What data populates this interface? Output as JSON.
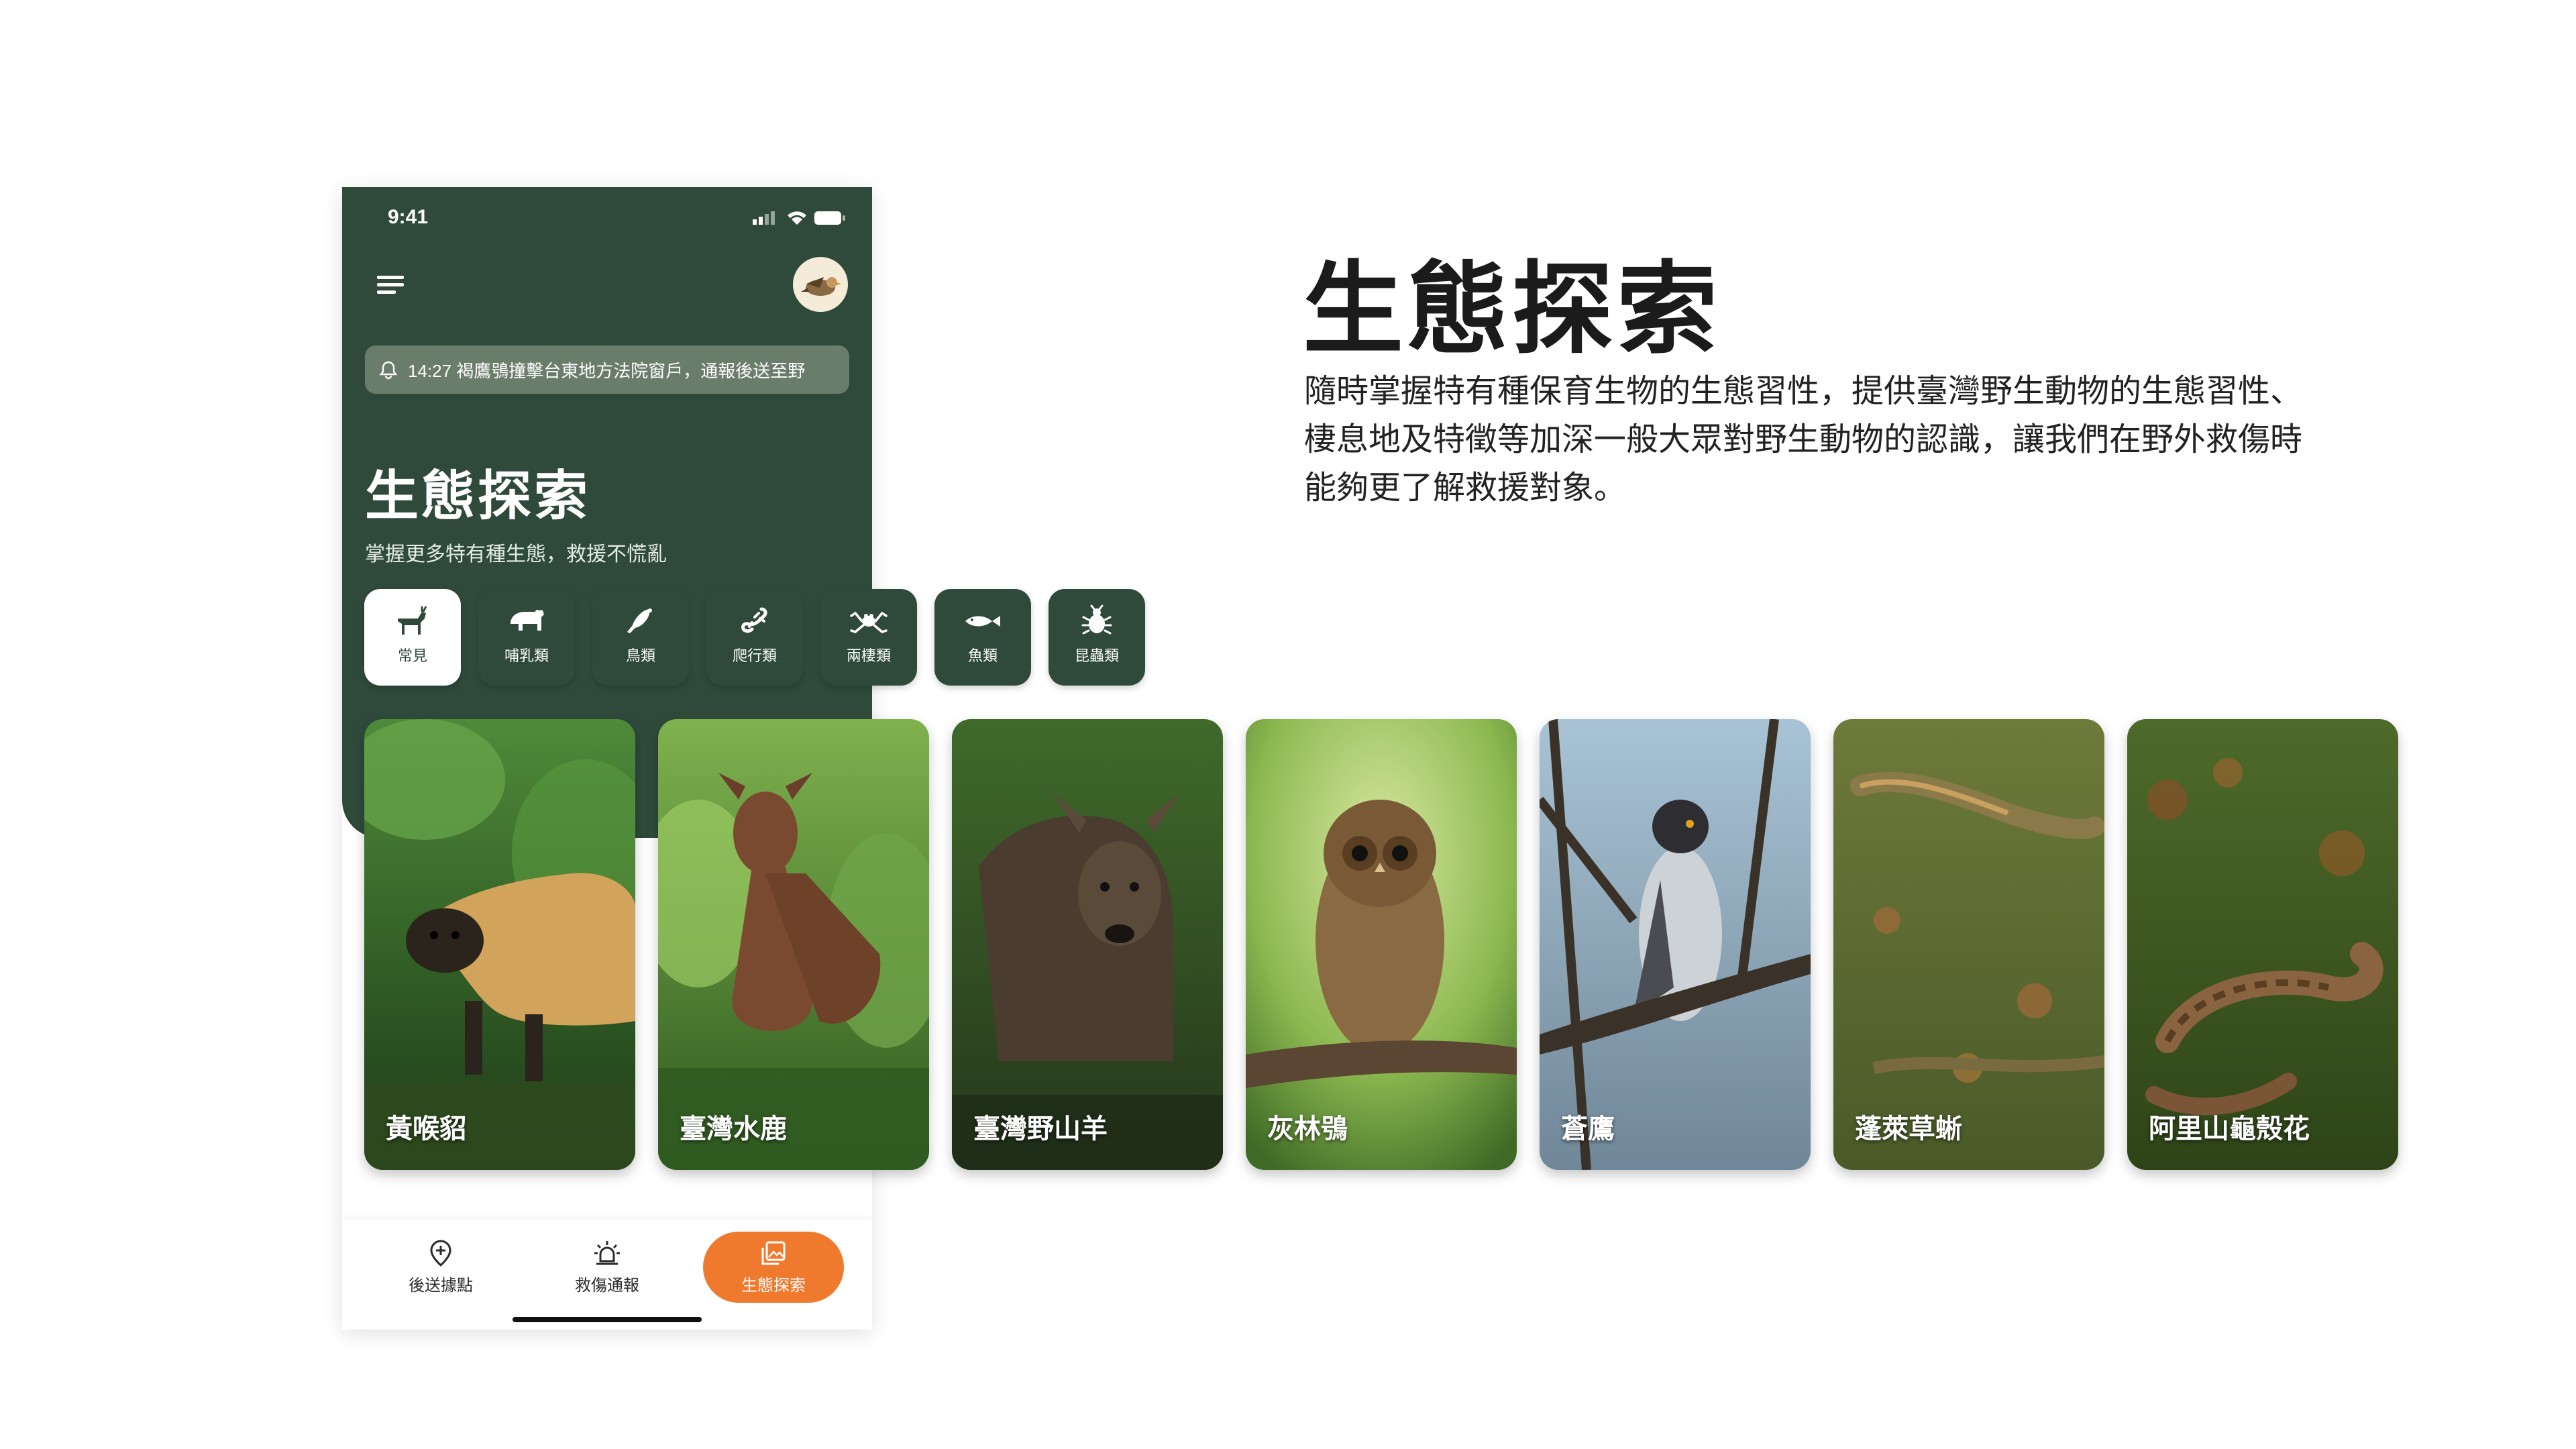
{
  "phone": {
    "status_time": "9:41",
    "menu_icon": "hamburger-menu-icon",
    "avatar_icon": "bird-avatar-icon",
    "notice": {
      "icon": "bell-icon",
      "text": "14:27 褐鷹鴞撞擊台東地方法院窗戶，通報後送至野"
    },
    "title": "生態探索",
    "subtitle": "掌握更多特有種生態，救援不慌亂"
  },
  "categories": [
    {
      "label": "常見",
      "icon": "goat-icon",
      "active": true
    },
    {
      "label": "哺乳類",
      "icon": "bear-icon",
      "active": false
    },
    {
      "label": "鳥類",
      "icon": "bird-icon",
      "active": false
    },
    {
      "label": "爬行類",
      "icon": "lizard-icon",
      "active": false
    },
    {
      "label": "兩棲類",
      "icon": "frog-icon",
      "active": false
    },
    {
      "label": "魚類",
      "icon": "fish-icon",
      "active": false
    },
    {
      "label": "昆蟲類",
      "icon": "beetle-icon",
      "active": false
    }
  ],
  "cards": [
    {
      "name": "黃喉貂"
    },
    {
      "name": "臺灣水鹿"
    },
    {
      "name": "臺灣野山羊"
    },
    {
      "name": "灰林鴞"
    },
    {
      "name": "蒼鷹"
    },
    {
      "name": "蓬萊草蜥"
    },
    {
      "name": "阿里山龜殼花"
    }
  ],
  "bottom_nav": [
    {
      "label": "後送據點",
      "icon": "location-pin-plus-icon",
      "active": false
    },
    {
      "label": "救傷通報",
      "icon": "siren-icon",
      "active": false
    },
    {
      "label": "生態探索",
      "icon": "gallery-icon",
      "active": true
    }
  ],
  "colors": {
    "primary_green": "#2f4a3b",
    "accent_orange": "#ef7a2e"
  },
  "description": {
    "title": "生態探索",
    "body_line1": "隨時掌握特有種保育生物的生態習性，提供臺灣野生動物的生態習性、",
    "body_line2": "棲息地及特徵等加深一般大眾對野生動物的認識，讓我們在野外救傷時",
    "body_line3": "能夠更了解救援對象。"
  }
}
